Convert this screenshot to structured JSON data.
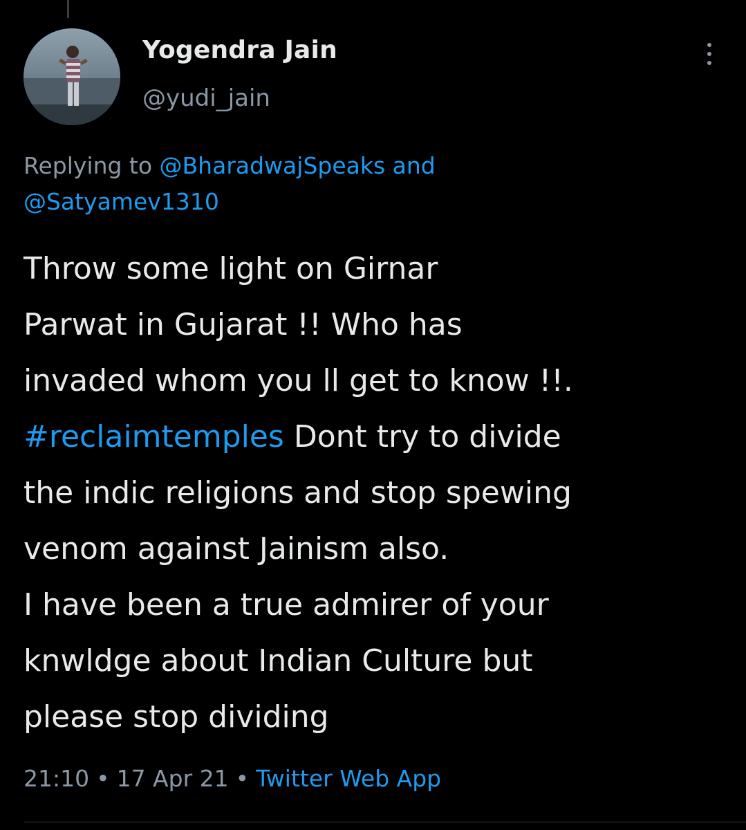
{
  "author": {
    "display_name": "Yogendra Jain",
    "handle": "@yudi_jain"
  },
  "reply_context": {
    "prefix": "Replying to ",
    "mention_1": "@BharadwajSpeaks",
    "joiner": " and",
    "mention_2": "@Satyamev1310"
  },
  "tweet": {
    "line_1": "Throw some light on Girnar",
    "line_2": "Parwat in Gujarat !! Who has",
    "line_3": "invaded whom you ll get to know !!.",
    "hashtag": "#reclaimtemples",
    "line_4_rest": " Dont try to divide",
    "line_5": "the indic religions and stop spewing",
    "line_6": "venom against Jainism also.",
    "line_7": "I have been a true admirer of your",
    "line_8": "knwldge about Indian Culture but",
    "line_9": "please stop dividing"
  },
  "meta": {
    "time": "21:10",
    "separator": "•",
    "date": "17 Apr 21",
    "source": "Twitter Web App"
  },
  "colors": {
    "background": "#000000",
    "text_primary": "#e7e9ea",
    "text_secondary": "#8b98a5",
    "accent_link": "#1d9bf0"
  },
  "icons": {
    "more": "more-vertical-icon",
    "avatar": "profile-photo"
  }
}
